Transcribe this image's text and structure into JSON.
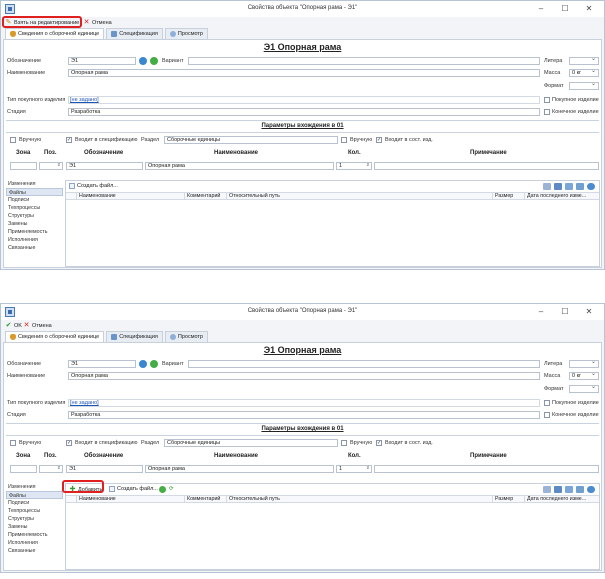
{
  "window": {
    "title": "Свойства объекта \"Опорная рама - Э1\"",
    "min": "–",
    "max": "☐",
    "close": "✕"
  },
  "toolbar1": {
    "edit": "Взять на редактирование",
    "cancel": "Отмена"
  },
  "toolbar2": {
    "ok": "OK",
    "cancel": "Отмена"
  },
  "tabs": [
    "Сведения о сборочной единице",
    "Спецификация",
    "Просмотр"
  ],
  "heading": "Э1 Опорная рама",
  "form": {
    "oboznachenie_label": "Обозначение",
    "oboznachenie_value": "Э1",
    "variant_label": "Вариант",
    "naimenovanie_label": "Наименование",
    "naimenovanie_value": "Опорная рама",
    "litera_label": "Литера",
    "massa_label": "Масса",
    "massa_unit": "0 кг",
    "format_label": "Формат",
    "tip_label": "Тип покупного изделия",
    "tip_value": "[не задано]",
    "pokupnoe_label": "Покупное изделие",
    "stadiya_label": "Стадия",
    "stadiya_value": "Разработка",
    "konechnoe_label": "Конечное изделие"
  },
  "params": {
    "title": "Параметры вхождения в 01",
    "vruchnuyu": "Вручную",
    "vhodit_spec": "Входит в спецификацию",
    "razdel_label": "Раздел",
    "razdel_value": "Сборочные единицы",
    "vruchnuyu2": "Вручную",
    "vhodit_sost": "Входит в сост. изд.",
    "col_zona": "Зона",
    "col_poz": "Поз.",
    "col_oboznachenie": "Обозначение",
    "col_naimenovanie": "Наименование",
    "col_kol": "Кол.",
    "col_primechanie": "Примечание",
    "row_oboznachenie": "Э1",
    "row_naimenovanie": "Опорная рама",
    "row_kol": "1"
  },
  "sidebar": [
    "Изменения",
    "Файлы",
    "Подписи",
    "Техпроцессы",
    "Структуры",
    "Замены",
    "Применяемость",
    "Исполнения",
    "Связанные"
  ],
  "files": {
    "add": "Добавить",
    "create": "Создать файл...",
    "columns": [
      "Наименование",
      "Комментарий",
      "Относительный путь",
      "Размер",
      "Дата последнего изме..."
    ]
  },
  "colors": {
    "highlight": "#e02020",
    "link": "#1d55b6",
    "accent": "#3a86d0"
  }
}
